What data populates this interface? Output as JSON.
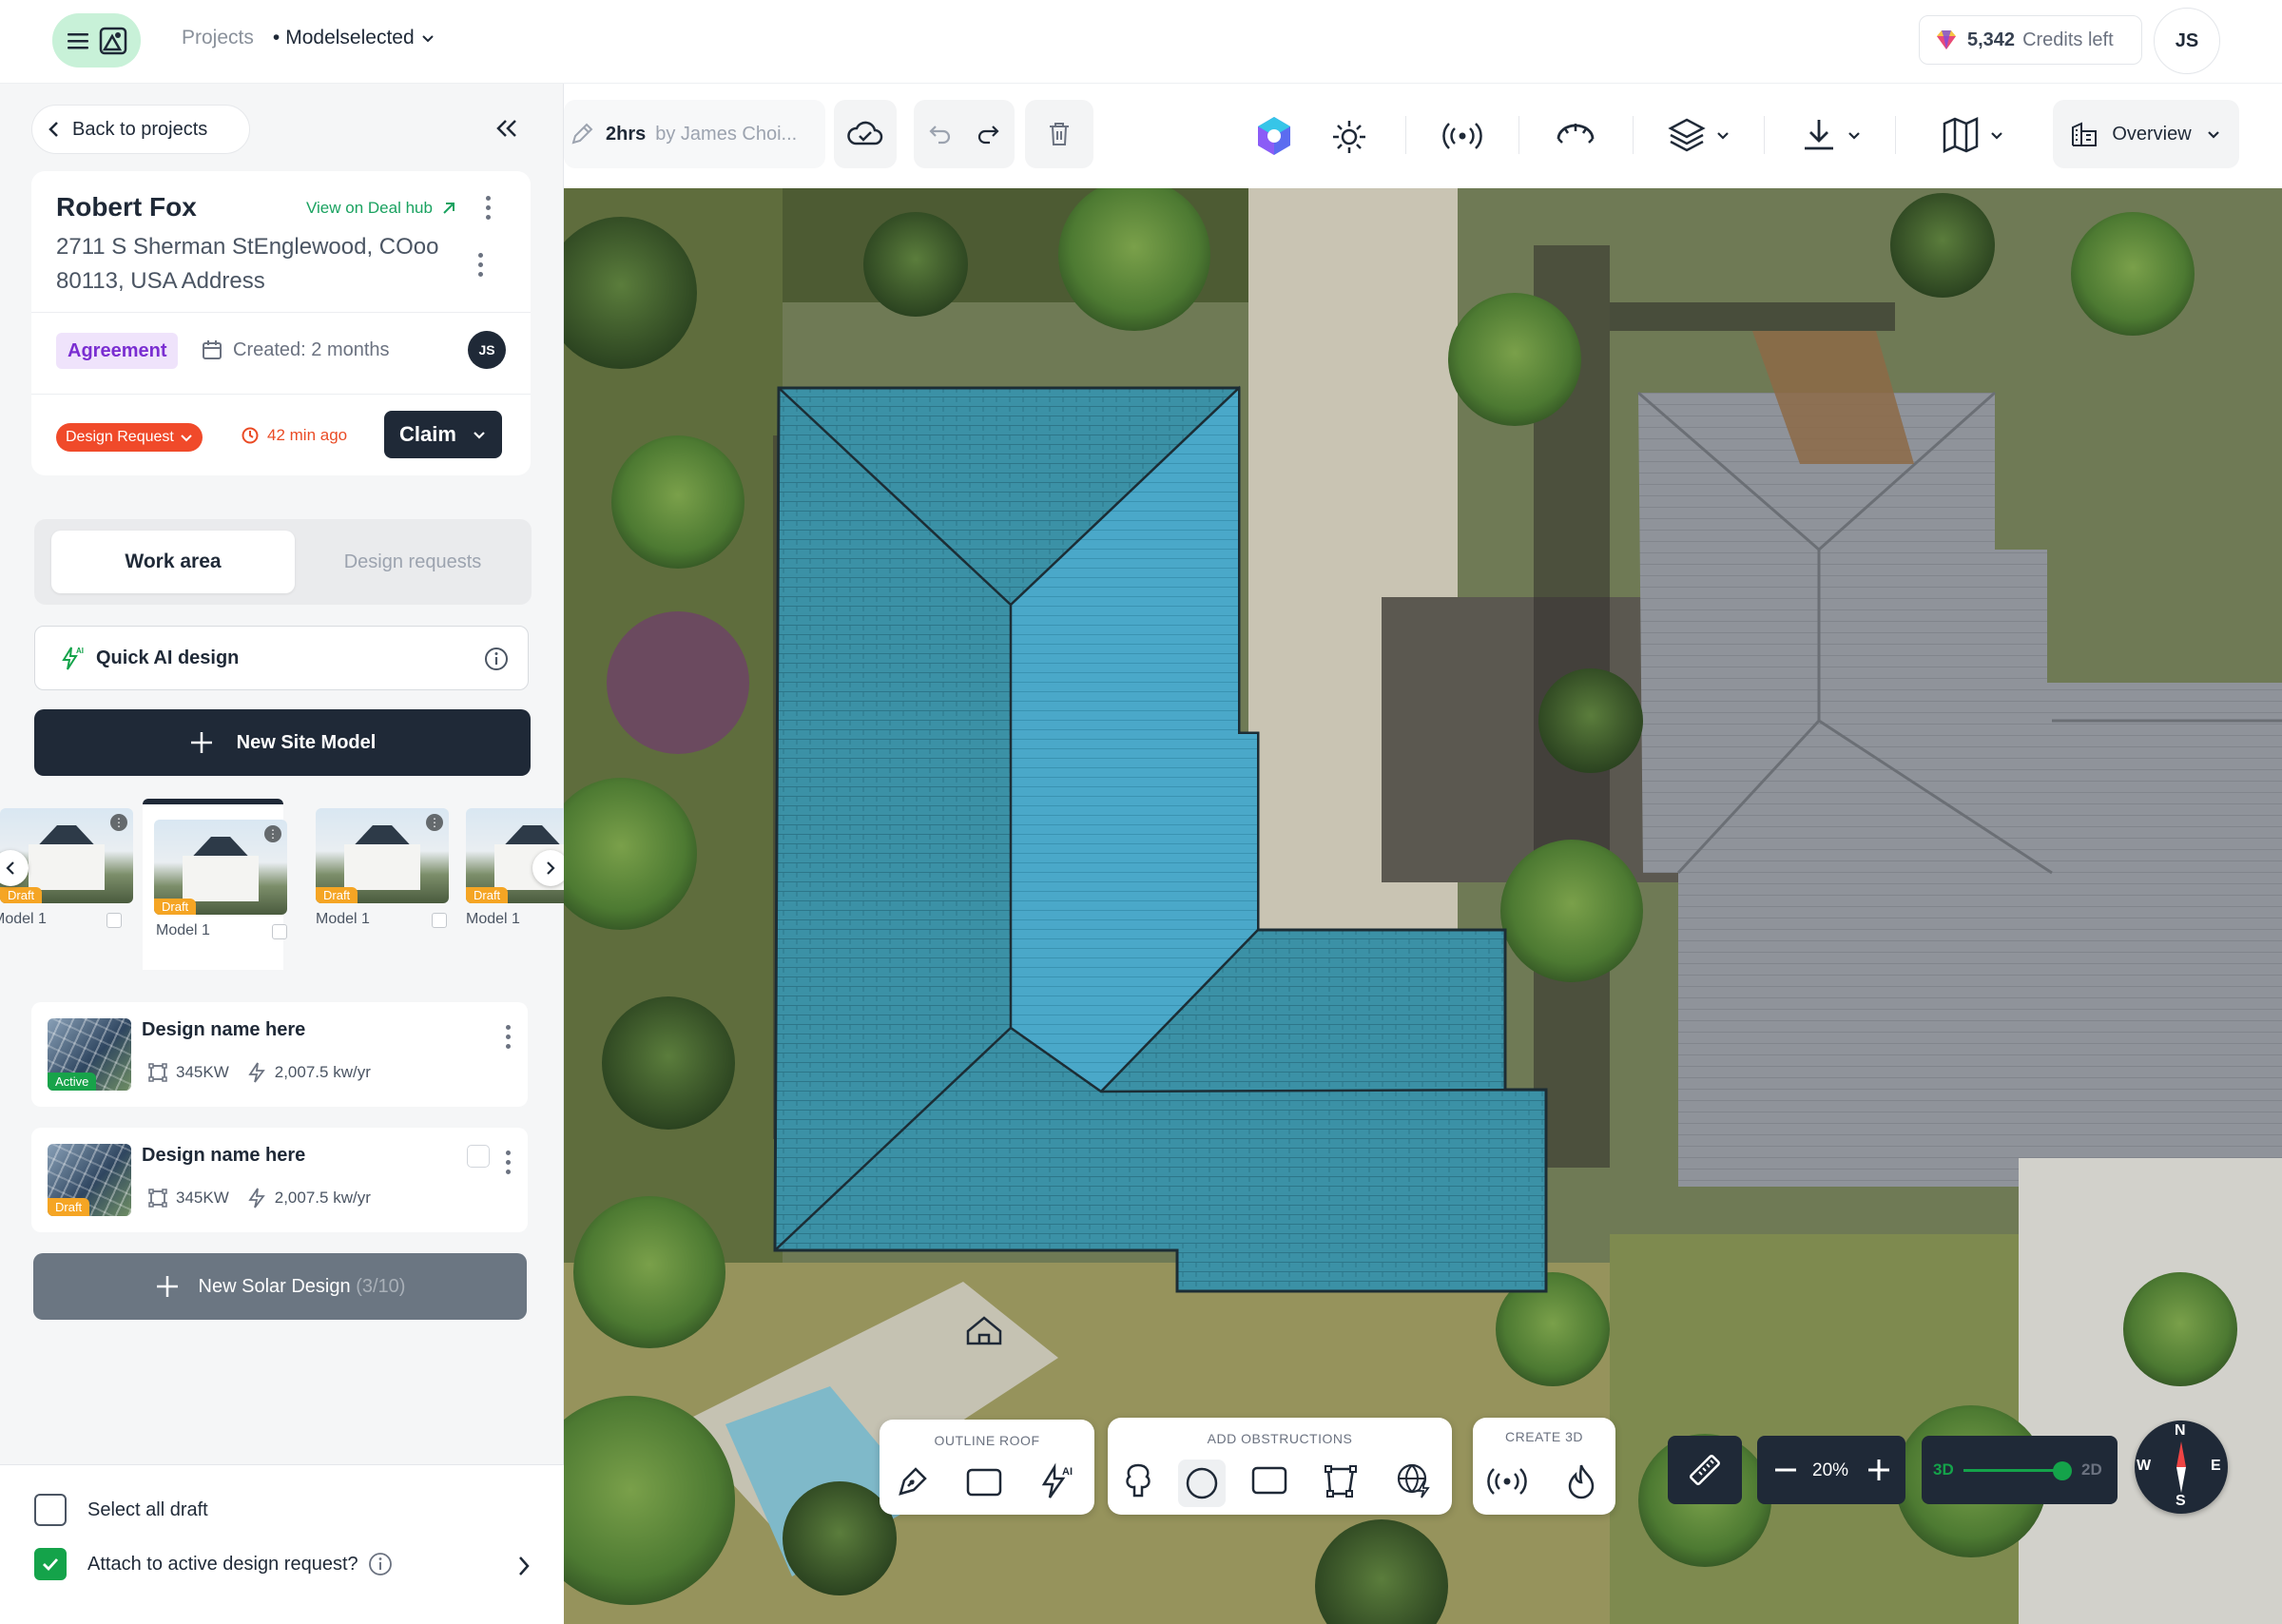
{
  "header": {
    "crumb_projects": "Projects",
    "crumb_model": "Modelselected",
    "credits_value": "5,342",
    "credits_label": "Credits left",
    "user_initials": "JS"
  },
  "sidebar": {
    "back_label": "Back to projects",
    "customer": {
      "name": "Robert Fox",
      "deal_link": "View on Deal hub",
      "address": "2711 S Sherman StEnglewood, COoo 80113, USA Address",
      "status_badge": "Agreement",
      "created": "Created: 2 months",
      "assignee_initials": "JS",
      "request_badge": "Design Request",
      "time_ago": "42 min ago",
      "claim_label": "Claim"
    },
    "tabs": {
      "active": "Work area",
      "inactive": "Design requests"
    },
    "quick_ai_label": "Quick AI design",
    "new_site_label": "New Site Model",
    "models": [
      {
        "label": "Model 1",
        "tag": "Draft"
      },
      {
        "label": "Model 1",
        "tag": "Draft"
      },
      {
        "label": "Model 1",
        "tag": "Draft"
      },
      {
        "label": "Model 1",
        "tag": "Draft"
      }
    ],
    "designs": [
      {
        "name": "Design name here",
        "tag": "Active",
        "tag_color": "#18a34a",
        "size": "345KW",
        "production": "2,007.5 kw/yr"
      },
      {
        "name": "Design name here",
        "tag": "Draft",
        "tag_color": "#f5a524",
        "size": "345KW",
        "production": "2,007.5 kw/yr"
      }
    ],
    "new_solar_label": "New Solar Design",
    "new_solar_count": "(3/10)",
    "select_all_label": "Select all draft",
    "attach_label": "Attach to active design request?"
  },
  "toolbar": {
    "edit_time": "2hrs",
    "edit_by": "by James Choi...",
    "view_label": "Overview"
  },
  "map": {
    "outline_roof_title": "OUTLINE ROOF",
    "obstructions_title": "ADD OBSTRUCTIONS",
    "create3d_title": "CREATE 3D",
    "zoom_level": "20%",
    "mode_3d": "3D",
    "mode_2d": "2D",
    "compass": {
      "n": "N",
      "s": "S",
      "e": "E",
      "w": "W"
    }
  },
  "colors": {
    "accent": "#14a34a",
    "dark": "#1f2937",
    "roof_fill": "#3aa6c6",
    "warning": "#f04a2a"
  }
}
